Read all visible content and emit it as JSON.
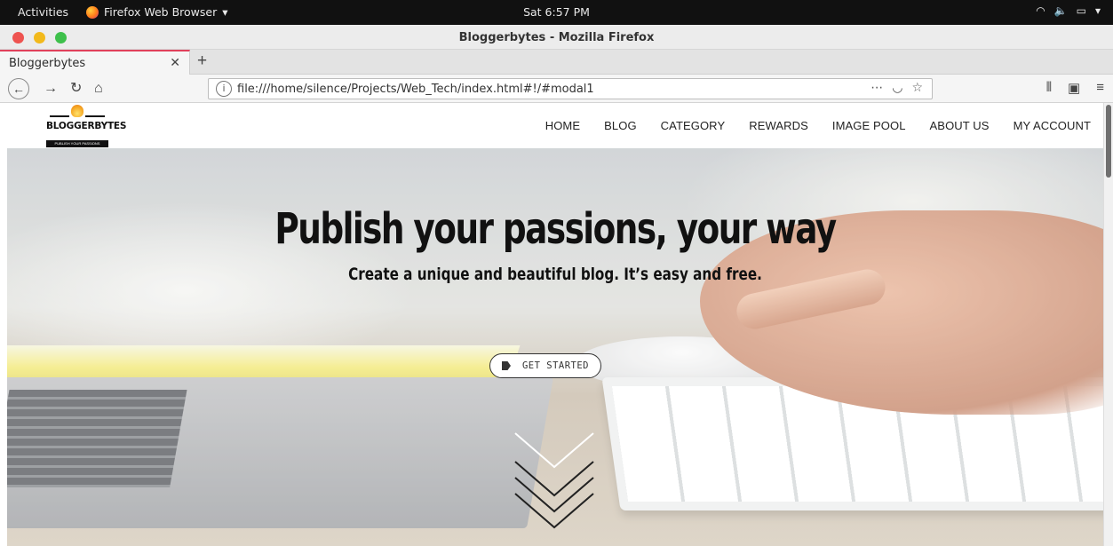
{
  "system": {
    "activities": "Activities",
    "app_name": "Firefox Web Browser",
    "clock": "Sat  6:57 PM"
  },
  "window": {
    "title": "Bloggerbytes - Mozilla Firefox",
    "dot_colors": [
      "#ee5350",
      "#f2b91b",
      "#3ec04b"
    ]
  },
  "tabs": [
    {
      "label": "Bloggerbytes",
      "active": true
    }
  ],
  "address_bar": {
    "url": "file:///home/silence/Projects/Web_Tech/index.html#!/#modal1",
    "page_actions": "⋯"
  },
  "site": {
    "logo_text": "BLOGGERBYTES",
    "logo_tagline": "PUBLISH YOUR PASSIONS",
    "nav": [
      "HOME",
      "BLOG",
      "CATEGORY",
      "REWARDS",
      "IMAGE POOL",
      "ABOUT US",
      "MY ACCOUNT"
    ],
    "hero": {
      "title": "Publish your passions, your way",
      "subtitle": "Create a unique and beautiful blog. It’s easy and free.",
      "cta_label": "GET STARTED"
    }
  },
  "colors": {
    "accent_tab": "#e0415b",
    "logo_flame": "#f5a623",
    "text_dark": "#111111"
  },
  "icons": [
    "wifi-icon",
    "volume-icon",
    "battery-icon",
    "back-icon",
    "forward-icon",
    "reload-icon",
    "home-icon",
    "info-icon",
    "pocket-icon",
    "star-icon",
    "library-icon",
    "sidebar-icon",
    "menu-icon",
    "tag-icon",
    "chevron-down-icon"
  ]
}
